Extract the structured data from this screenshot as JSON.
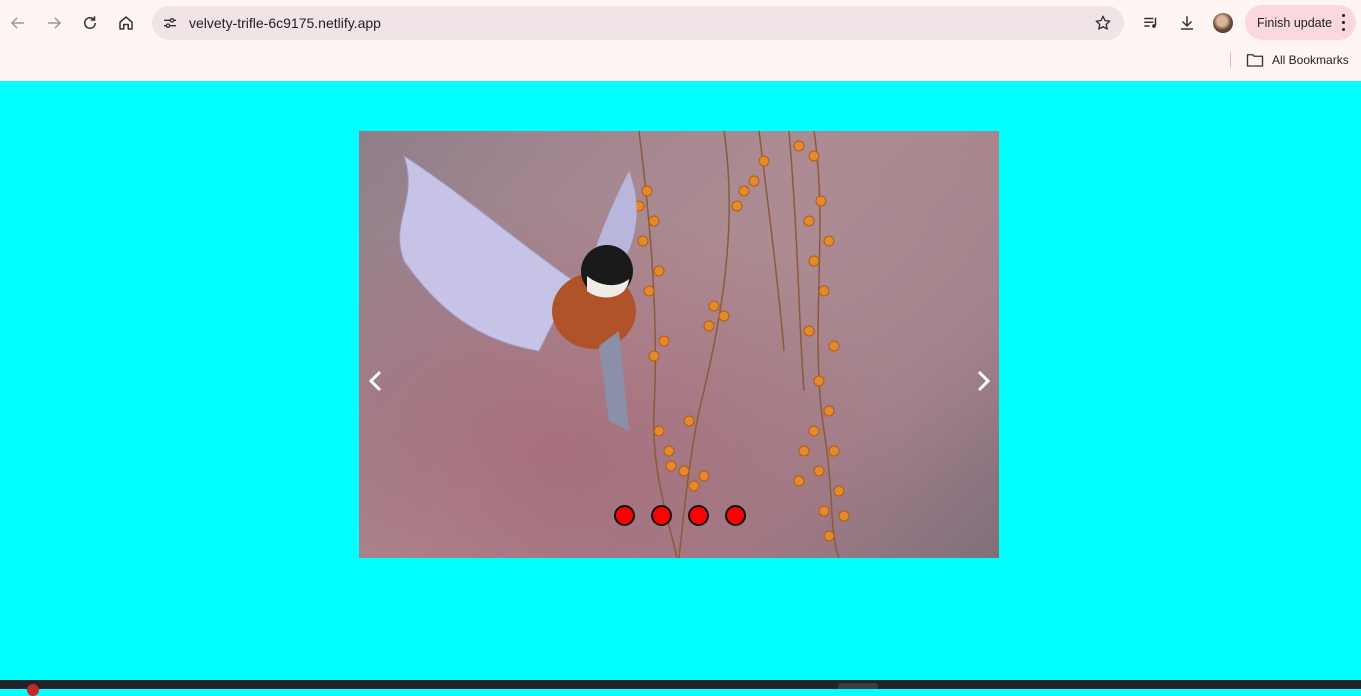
{
  "browser": {
    "url": "velvety-trifle-6c9175.netlify.app",
    "finish_update_label": "Finish update",
    "bookmarks_label": "All Bookmarks",
    "icons": {
      "back": "arrow-left-icon",
      "forward": "arrow-right-icon",
      "reload": "reload-icon",
      "home": "home-icon",
      "site_info": "tune-icon",
      "bookmark_star": "star-icon",
      "media": "playlist-icon",
      "downloads": "download-icon",
      "profile": "avatar",
      "menu": "kebab-menu-icon",
      "folder": "folder-icon"
    }
  },
  "page": {
    "background_color": "#00ffff",
    "slider": {
      "image": "bird-with-berries-photo",
      "prev_icon": "chevron-left-icon",
      "next_icon": "chevron-right-icon",
      "dot_count": 4,
      "dot_color": "#ff0000"
    }
  }
}
